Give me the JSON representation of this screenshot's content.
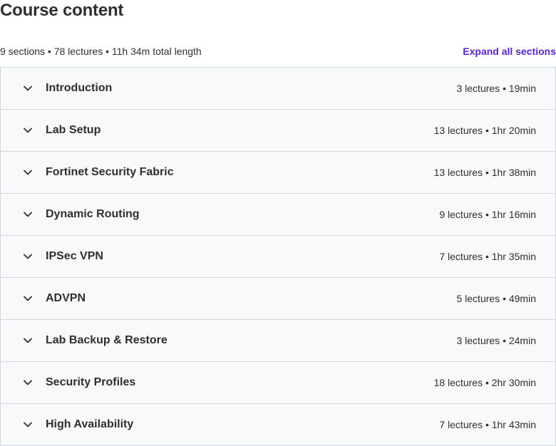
{
  "page_title": "Course content",
  "summary": "9 sections • 78 lectures • 11h 34m total length",
  "expand_all_label": "Expand all sections",
  "icons": {
    "section_toggle": "chevron-down-icon"
  },
  "colors": {
    "link": "#5624d0",
    "row_background": "#f7f9fa",
    "border": "#d1d7dc",
    "text": "#2d2f31"
  },
  "sections": [
    {
      "title": "Introduction",
      "meta": "3 lectures • 19min"
    },
    {
      "title": "Lab Setup",
      "meta": "13 lectures • 1hr 20min"
    },
    {
      "title": "Fortinet Security Fabric",
      "meta": "13 lectures • 1hr 38min"
    },
    {
      "title": "Dynamic Routing",
      "meta": "9 lectures • 1hr 16min"
    },
    {
      "title": "IPSec VPN",
      "meta": "7 lectures • 1hr 35min"
    },
    {
      "title": "ADVPN",
      "meta": "5 lectures • 49min"
    },
    {
      "title": "Lab Backup & Restore",
      "meta": "3 lectures • 24min"
    },
    {
      "title": "Security Profiles",
      "meta": "18 lectures • 2hr 30min"
    },
    {
      "title": "High Availability",
      "meta": "7 lectures • 1hr 43min"
    }
  ]
}
